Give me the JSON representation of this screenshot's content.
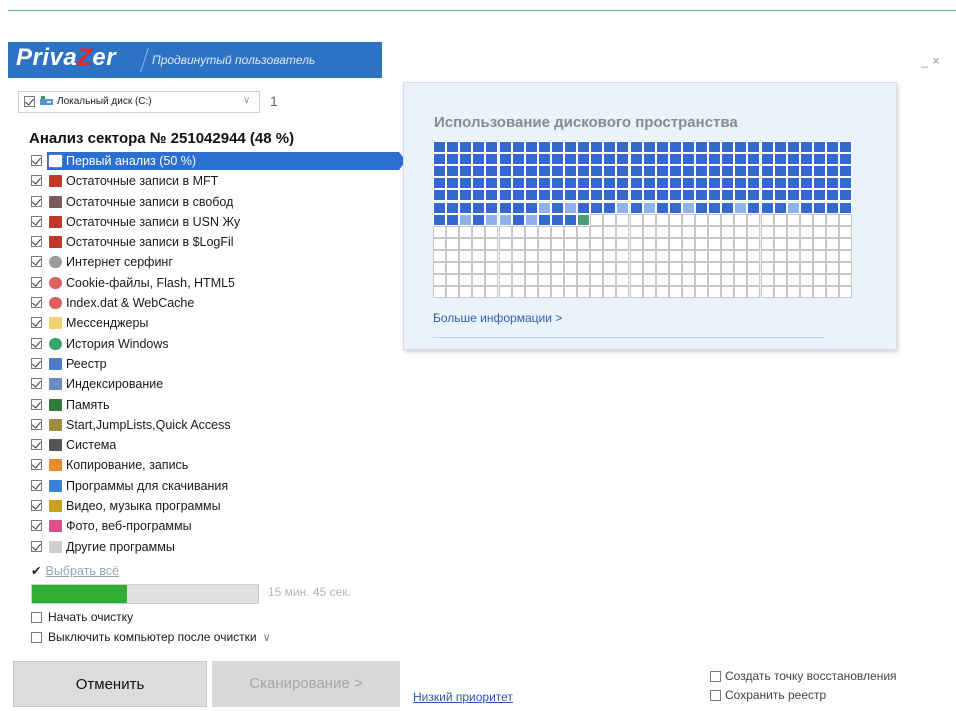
{
  "app": {
    "logo_part1": "Priva",
    "logo_part2": "Z",
    "logo_part3": "er",
    "mode": "Продвинутый пользователь",
    "minimize": "_",
    "close": "×"
  },
  "drive": {
    "label": "Локальный диск (C:)",
    "checked": true,
    "count": "1"
  },
  "analysis_title": "Анализ сектора № 251042944 (48 %)",
  "items": [
    {
      "label": "Первый анализ (50 %)",
      "icon": "grid-icon",
      "color": "#5a7fc8",
      "active": true
    },
    {
      "label": "Остаточные записи в  MFT",
      "icon": "table-red-icon",
      "color": "#c0392b"
    },
    {
      "label": "Остаточные записи в свобод",
      "icon": "grid-dark-icon",
      "color": "#7a5a5a"
    },
    {
      "label": "Остаточные записи в USN Жу",
      "icon": "table-red-icon",
      "color": "#c0392b"
    },
    {
      "label": "Остаточные записи в  $LogFil",
      "icon": "table-red-icon",
      "color": "#c0392b"
    },
    {
      "label": "Интернет серфинг",
      "icon": "mouse-icon",
      "color": "#9a9a9a"
    },
    {
      "label": "Cookie-файлы, Flash, HTML5",
      "icon": "mouse-red-icon",
      "color": "#e06060"
    },
    {
      "label": "Index.dat & WebCache",
      "icon": "mouse-red-icon",
      "color": "#e06060"
    },
    {
      "label": "Мессенджеры",
      "icon": "chat-icon",
      "color": "#f2d36b"
    },
    {
      "label": "История Windows",
      "icon": "clock-icon",
      "color": "#3aa36b"
    },
    {
      "label": "Реестр",
      "icon": "registry-icon",
      "color": "#4c7dc9"
    },
    {
      "label": "Индексирование",
      "icon": "index-icon",
      "color": "#6b8cc0"
    },
    {
      "label": "Память",
      "icon": "memory-icon",
      "color": "#2d7a3a"
    },
    {
      "label": "Start,JumpLists,Quick Access",
      "icon": "pin-icon",
      "color": "#a08a40"
    },
    {
      "label": "Система",
      "icon": "system-icon",
      "color": "#555555"
    },
    {
      "label": "Копирование, запись",
      "icon": "flame-icon",
      "color": "#e98b2a"
    },
    {
      "label": "Программы для скачивания",
      "icon": "download-icon",
      "color": "#3a7fd9"
    },
    {
      "label": "Видео, музыка программы",
      "icon": "media-icon",
      "color": "#c9a020"
    },
    {
      "label": "Фото, веб-программы",
      "icon": "photo-icon",
      "color": "#d9508a"
    },
    {
      "label": "Другие программы",
      "icon": "window-icon",
      "color": "#cfcfcf"
    }
  ],
  "select_all": {
    "check": "✔",
    "label": "Выбрать всё"
  },
  "progress": {
    "fraction": 0.42,
    "eta": "15 мин. 45 сек."
  },
  "options": {
    "start_cleanup": "Начать очистку",
    "shutdown": "Выключить компьютер после очистки",
    "shutdown_chevron": "∨"
  },
  "buttons": {
    "cancel": "Отменить",
    "scan": "Сканирование >",
    "low_priority": "Низкий приоритет"
  },
  "right_options": {
    "restore_point": "Создать точку восстановления",
    "save_registry": "Сохранить реестр"
  },
  "disk_panel": {
    "title": "Использование дискового пространства",
    "more": "Больше информации >",
    "colors": {
      "used": "#3569cf",
      "partial": "#8fb2e8",
      "current": "#4a9d78",
      "empty": "#ffffff"
    }
  }
}
